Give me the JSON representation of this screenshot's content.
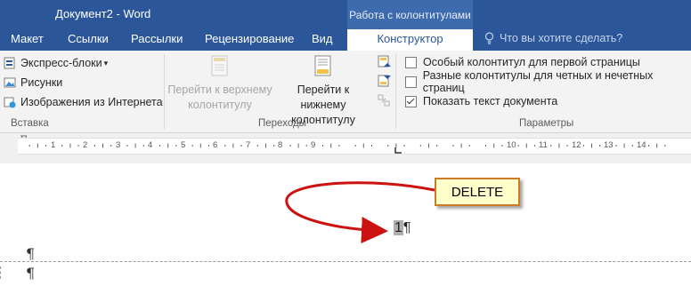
{
  "titlebar": {
    "document_title": "Документ2 - Word",
    "context_title": "Работа с колонтитулами"
  },
  "tabs": [
    {
      "label": "Макет"
    },
    {
      "label": "Ссылки"
    },
    {
      "label": "Рассылки"
    },
    {
      "label": "Рецензирование"
    },
    {
      "label": "Вид"
    },
    {
      "label": "Конструктор",
      "active": true
    }
  ],
  "tellme": {
    "text": "Что вы хотите сделать?"
  },
  "ribbon": {
    "insert_group": {
      "items": [
        {
          "label": "Экспресс-блоки",
          "dropdown": "▾"
        },
        {
          "label": "Рисунки"
        },
        {
          "label": "Изображения из Интернета"
        }
      ],
      "label": "Вставка"
    },
    "navigation_group": {
      "prev_line1": "Перейти к верхнему",
      "prev_line2": "колонтитулу",
      "next_line1": "Перейти к нижнему",
      "next_line2": "колонтитулу",
      "label": "Переходы"
    },
    "options_group": {
      "options": [
        {
          "label": "Особый колонтитул для первой страницы",
          "checked": false
        },
        {
          "label": "Разные колонтитулы для четных и нечетных страниц",
          "checked": false
        },
        {
          "label": "Показать текст документа",
          "checked": true
        }
      ],
      "label": "Параметры"
    }
  },
  "ruler": {
    "numbers": [
      "1",
      "2",
      "3",
      "4",
      "5",
      "6",
      "7",
      "8",
      "9",
      "10",
      "11",
      "12",
      "13",
      "14"
    ]
  },
  "document": {
    "page_number": "1",
    "pilcrow": "¶",
    "callout_text": "DELETE"
  },
  "colors": {
    "word_blue": "#2b579a",
    "callout_fill": "#ffffcc",
    "callout_border": "#d07a26",
    "arrow_red": "#cc1111"
  }
}
